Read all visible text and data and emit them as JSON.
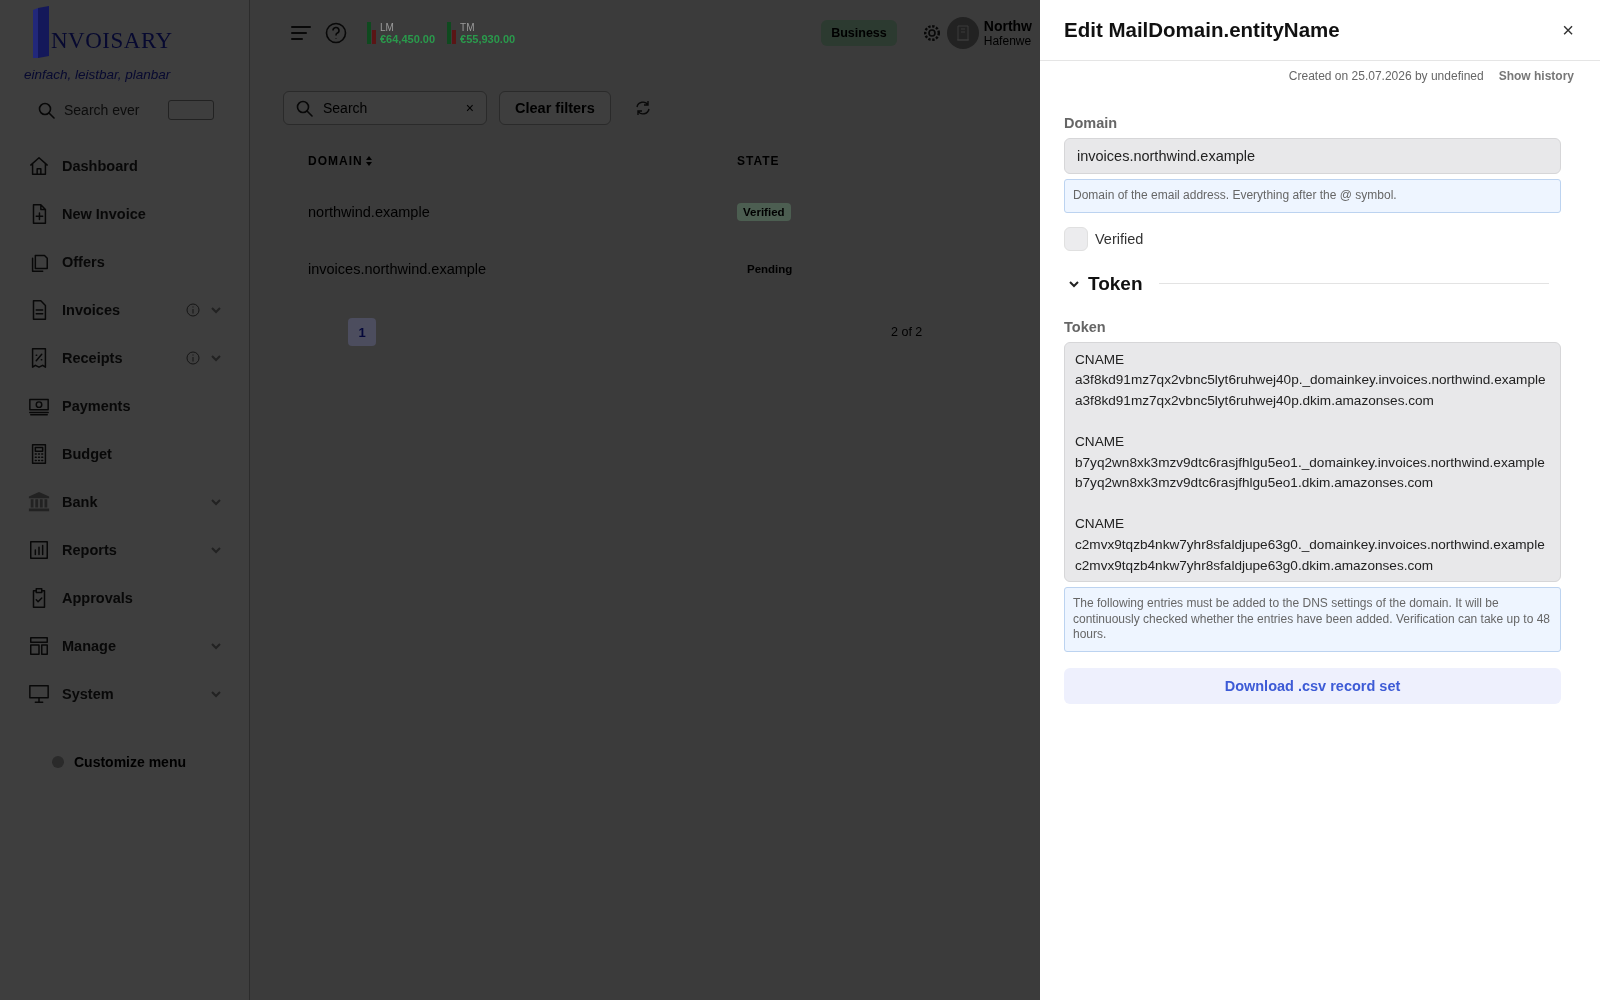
{
  "app": {
    "logo": "NVOISARY",
    "tagline": "einfach, leistbar, planbar",
    "search": {
      "placeholder": "Search ever"
    }
  },
  "sidebar": {
    "items": [
      {
        "label": "Dashboard",
        "info": false,
        "expandable": false
      },
      {
        "label": "New Invoice",
        "info": false,
        "expandable": false
      },
      {
        "label": "Offers",
        "info": false,
        "expandable": false
      },
      {
        "label": "Invoices",
        "info": true,
        "expandable": true
      },
      {
        "label": "Receipts",
        "info": true,
        "expandable": true
      },
      {
        "label": "Payments",
        "info": false,
        "expandable": false
      },
      {
        "label": "Budget",
        "info": false,
        "expandable": false
      },
      {
        "label": "Bank",
        "info": false,
        "expandable": true
      },
      {
        "label": "Reports",
        "info": false,
        "expandable": true
      },
      {
        "label": "Approvals",
        "info": false,
        "expandable": false
      },
      {
        "label": "Manage",
        "info": false,
        "expandable": true
      },
      {
        "label": "System",
        "info": false,
        "expandable": true
      }
    ],
    "customize": "Customize menu"
  },
  "header": {
    "stats": [
      {
        "label": "LM",
        "value": "€64,450.00"
      },
      {
        "label": "TM",
        "value": "€55,930.00"
      }
    ],
    "plan": "Business",
    "company": {
      "name": "Northw",
      "address": "Hafenwe"
    }
  },
  "table": {
    "search": {
      "placeholder": "Search",
      "clear": "×"
    },
    "clear_filters": "Clear filters",
    "columns": [
      "DOMAIN",
      "STATE"
    ],
    "rows": [
      {
        "domain": "northwind.example",
        "state": "Verified",
        "kind": "verified"
      },
      {
        "domain": "invoices.northwind.example",
        "state": "Pending",
        "kind": "pending"
      }
    ],
    "pagination": {
      "pages": [
        {
          "label": "1",
          "selected": true
        }
      ],
      "summary": "2 of 2"
    }
  },
  "drawer": {
    "title": "Edit MailDomain.entityName",
    "close": "×",
    "created": "Created on 25.07.2026 by undefined",
    "history_link": "Show history",
    "domain": {
      "label": "Domain",
      "value": "invoices.northwind.example",
      "hint": "Domain of the email address. Everything after the @ symbol."
    },
    "verified": {
      "label": "Verified",
      "checked": false
    },
    "token_section": {
      "title": "Token",
      "expanded": true,
      "label": "Token",
      "value": "CNAME\na3f8kd91mz7qx2vbnc5lyt6ruhwej40p._domainkey.invoices.northwind.example\na3f8kd91mz7qx2vbnc5lyt6ruhwej40p.dkim.amazonses.com\n\nCNAME\nb7yq2wn8xk3mzv9dtc6rasjfhlgu5eo1._domainkey.invoices.northwind.example\nb7yq2wn8xk3mzv9dtc6rasjfhlgu5eo1.dkim.amazonses.com\n\nCNAME\nc2mvx9tqzb4nkw7yhr8sfaldjupe63g0._domainkey.invoices.northwind.example\nc2mvx9tqzb4nkw7yhr8sfaldjupe63g0.dkim.amazonses.com",
      "hint": "The following entries must be added to the DNS settings of the domain. It will be continuously checked whether the entries have been added. Verification can take up to 48 hours.",
      "download": "Download .csv record set"
    }
  }
}
